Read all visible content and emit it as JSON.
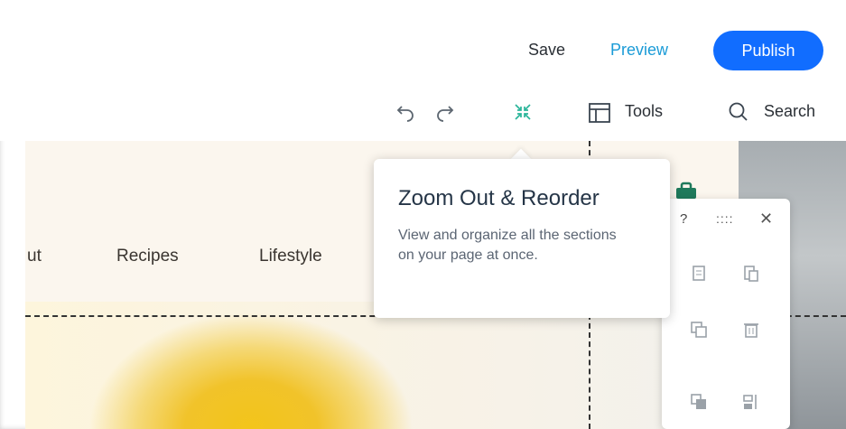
{
  "header": {
    "save_label": "Save",
    "preview_label": "Preview",
    "publish_label": "Publish",
    "publish_color": "#116dff",
    "preview_color": "#1a9bd7"
  },
  "toolbar": {
    "undo_icon": "undo-icon",
    "redo_icon": "redo-icon",
    "zoom_icon": "zoom-out-reorder-icon",
    "tools_label": "Tools",
    "search_label": "Search"
  },
  "site_nav": {
    "items": [
      "ut",
      "Recipes",
      "Lifestyle"
    ]
  },
  "tooltip": {
    "title": "Zoom Out & Reorder",
    "body": "View and organize all the sections on your page at once."
  },
  "panel": {
    "help": "?",
    "drag": "::::",
    "close": "✕",
    "icons": [
      "copy-icon",
      "paste-icon",
      "duplicate-icon",
      "delete-icon",
      "move-forward-icon",
      "arrange-icon"
    ]
  }
}
